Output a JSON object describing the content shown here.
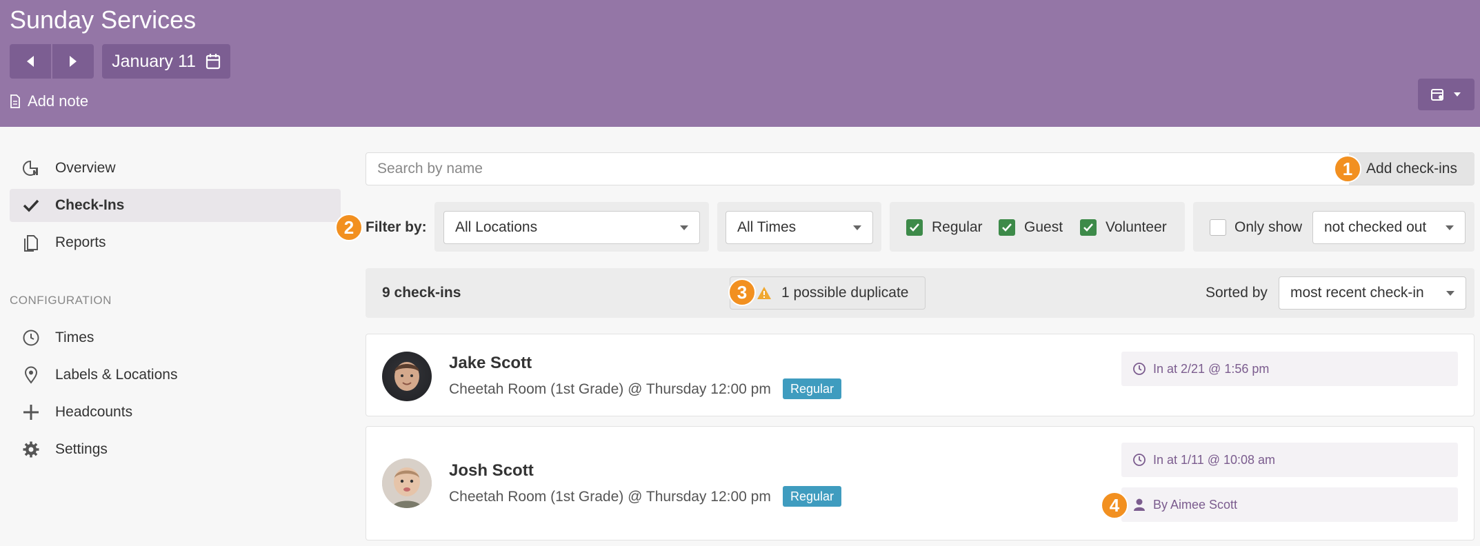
{
  "header": {
    "title": "Sunday Services",
    "date": "January 11",
    "add_note": "Add note"
  },
  "sidebar": {
    "items": [
      {
        "label": "Overview",
        "icon": "chart-pie-icon"
      },
      {
        "label": "Check-Ins",
        "icon": "checkmark-icon",
        "active": true
      },
      {
        "label": "Reports",
        "icon": "documents-icon"
      }
    ],
    "config_label": "CONFIGURATION",
    "config_items": [
      {
        "label": "Times",
        "icon": "clock-icon"
      },
      {
        "label": "Labels & Locations",
        "icon": "map-pin-icon"
      },
      {
        "label": "Headcounts",
        "icon": "plus-icon"
      },
      {
        "label": "Settings",
        "icon": "gear-icon"
      }
    ]
  },
  "search": {
    "placeholder": "Search by name",
    "add_button": "Add check-ins"
  },
  "filters": {
    "label": "Filter by:",
    "location": "All Locations",
    "time": "All Times",
    "kinds": [
      {
        "label": "Regular",
        "checked": true
      },
      {
        "label": "Guest",
        "checked": true
      },
      {
        "label": "Volunteer",
        "checked": true
      }
    ],
    "only_show": {
      "label": "Only show",
      "checked": false,
      "value": "not checked out"
    }
  },
  "summary": {
    "count": "9 check-ins",
    "duplicates": "1 possible duplicate",
    "sorted_label": "Sorted by",
    "sorted_value": "most recent check-in"
  },
  "callouts": [
    "1",
    "2",
    "3",
    "4"
  ],
  "checkins": [
    {
      "name": "Jake Scott",
      "location": "Cheetah Room (1st Grade) @ Thursday 12:00 pm",
      "tag": "Regular",
      "checked_in": "In at 2/21 @ 1:56 pm"
    },
    {
      "name": "Josh Scott",
      "location": "Cheetah Room (1st Grade) @ Thursday 12:00 pm",
      "tag": "Regular",
      "checked_in": "In at 1/11 @ 10:08 am",
      "by": "By Aimee Scott"
    }
  ],
  "colors": {
    "header": "#9476a6",
    "accent": "#f29020",
    "tag": "#3f9cbf",
    "checkbox": "#3d8a49"
  }
}
